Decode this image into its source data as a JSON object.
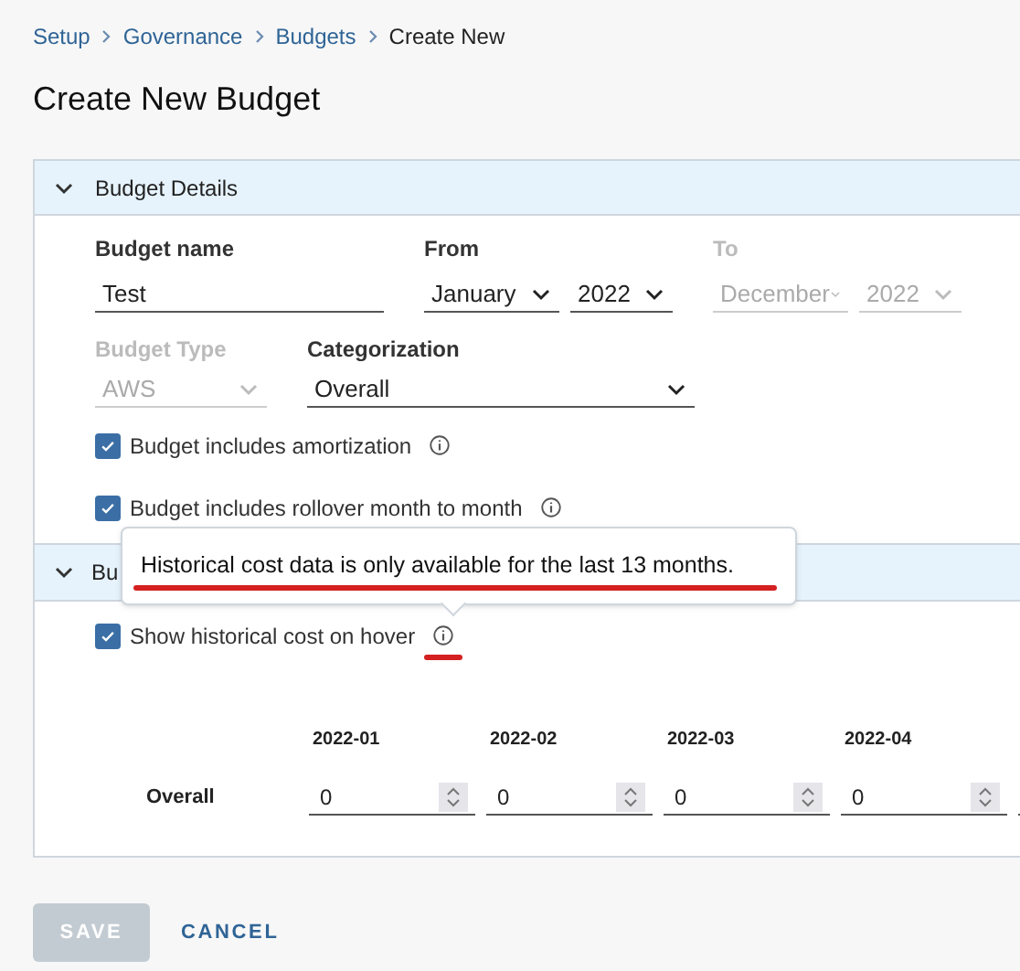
{
  "breadcrumb": [
    {
      "label": "Setup",
      "kind": "link"
    },
    {
      "label": "Governance",
      "kind": "link"
    },
    {
      "label": "Budgets",
      "kind": "link"
    },
    {
      "label": "Create New",
      "kind": "current"
    }
  ],
  "title": "Create New Budget",
  "details": {
    "header": "Budget Details",
    "expanded": true,
    "budget_name": {
      "label": "Budget name",
      "value": "Test"
    },
    "from": {
      "label": "From",
      "month": "January",
      "year": "2022",
      "disabled": false
    },
    "to": {
      "label": "To",
      "month": "December",
      "year": "2022",
      "disabled": true
    },
    "budget_type": {
      "label": "Budget Type",
      "value": "AWS",
      "disabled": true
    },
    "categorization": {
      "label": "Categorization",
      "value": "Overall",
      "disabled": false
    },
    "checkboxes": [
      {
        "label": "Budget includes amortization",
        "checked": true
      },
      {
        "label": "Budget includes rollover month to month",
        "checked": true
      }
    ]
  },
  "amounts": {
    "header": "Bu",
    "expanded": true,
    "show_history": {
      "label": "Show historical cost on hover",
      "checked": true
    },
    "tooltip": "Historical cost data is only available for the last 13 months.",
    "columns": [
      "2022-01",
      "2022-02",
      "2022-03",
      "2022-04"
    ],
    "rows": [
      {
        "label": "Overall",
        "values": [
          "0",
          "0",
          "0",
          "0"
        ]
      }
    ]
  },
  "actions": [
    {
      "label": "SAVE",
      "kind": "primary",
      "disabled": true
    },
    {
      "label": "CANCEL",
      "kind": "link",
      "disabled": false
    }
  ]
}
